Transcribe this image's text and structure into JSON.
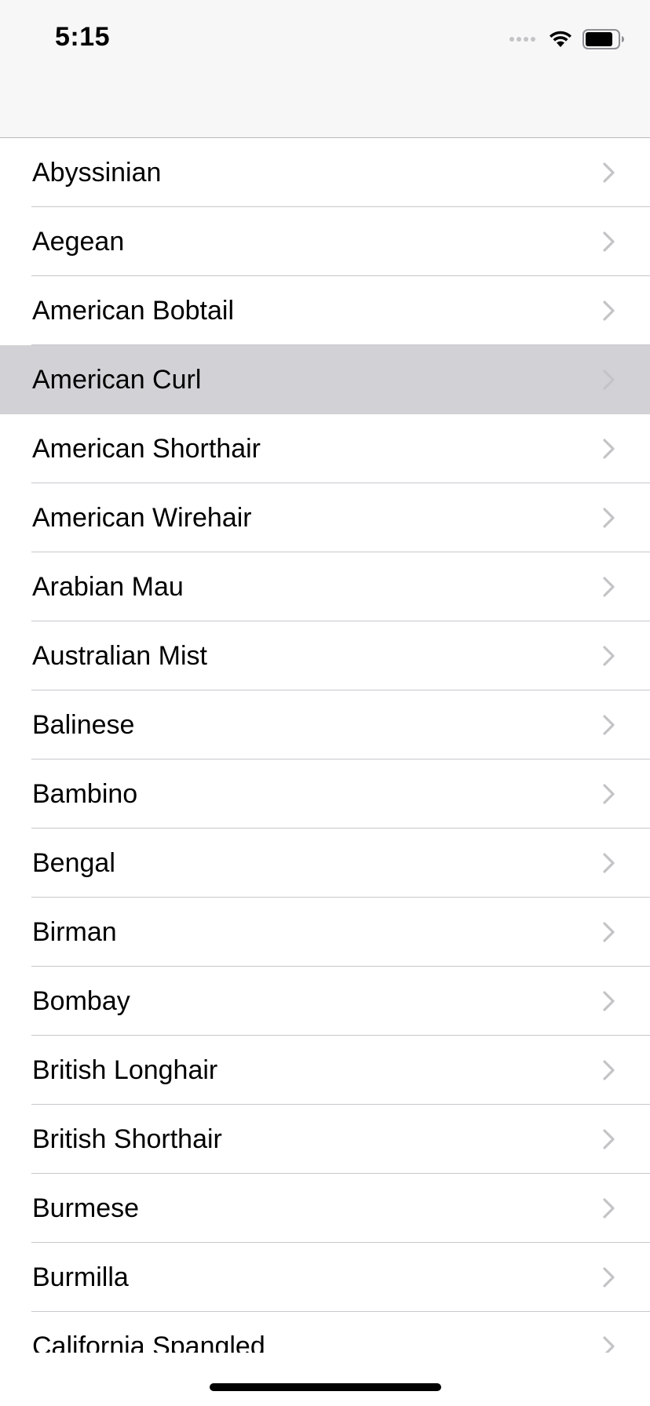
{
  "status_bar": {
    "time": "5:15"
  },
  "colors": {
    "row_highlight": "#d1d1d6",
    "chevron": "#c4c4c7",
    "navbar_background": "#f7f7f7"
  },
  "icons": {
    "row_accessory": "chevron-right-icon",
    "wifi": "wifi-icon",
    "battery": "battery-icon",
    "signal": "cellular-signal-icon"
  },
  "list": {
    "highlighted_index": 3,
    "items": [
      {
        "label": "Abyssinian"
      },
      {
        "label": "Aegean"
      },
      {
        "label": "American Bobtail"
      },
      {
        "label": "American Curl"
      },
      {
        "label": "American Shorthair"
      },
      {
        "label": "American Wirehair"
      },
      {
        "label": "Arabian Mau"
      },
      {
        "label": "Australian Mist"
      },
      {
        "label": "Balinese"
      },
      {
        "label": "Bambino"
      },
      {
        "label": "Bengal"
      },
      {
        "label": "Birman"
      },
      {
        "label": "Bombay"
      },
      {
        "label": "British Longhair"
      },
      {
        "label": "British Shorthair"
      },
      {
        "label": "Burmese"
      },
      {
        "label": "Burmilla"
      },
      {
        "label": "California Spangled"
      }
    ]
  }
}
